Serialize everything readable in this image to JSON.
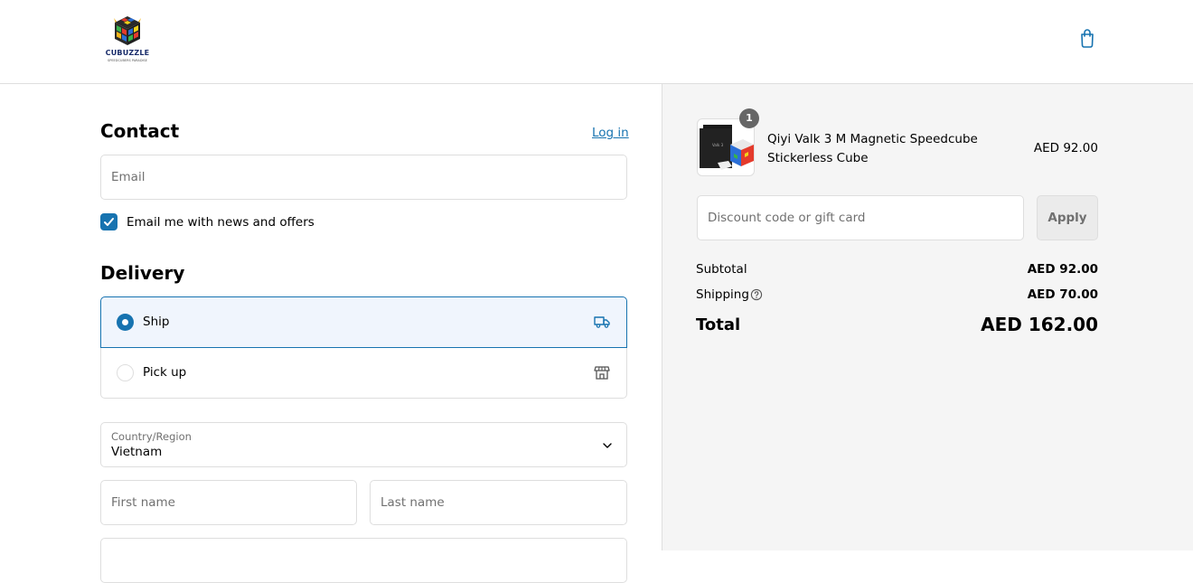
{
  "header": {
    "logo_text": "CUBUZZLE",
    "logo_sub": "SPEEDCUBERS PARADISE",
    "cart_icon": "shopping-bag-icon"
  },
  "contact": {
    "title": "Contact",
    "login_label": "Log in",
    "email_placeholder": "Email",
    "newsletter_label": "Email me with news and offers",
    "newsletter_checked": true
  },
  "delivery": {
    "title": "Delivery",
    "options": [
      {
        "label": "Ship",
        "selected": true,
        "icon": "truck-icon"
      },
      {
        "label": "Pick up",
        "selected": false,
        "icon": "store-icon"
      }
    ],
    "country_label": "Country/Region",
    "country_value": "Vietnam",
    "first_name_placeholder": "First name",
    "last_name_placeholder": "Last name"
  },
  "summary": {
    "product": {
      "name": "Qiyi Valk 3 M Magnetic Speedcube Stickerless Cube",
      "price": "AED 92.00",
      "quantity": "1"
    },
    "discount_placeholder": "Discount code or gift card",
    "apply_label": "Apply",
    "subtotal_label": "Subtotal",
    "subtotal_value": "AED 92.00",
    "shipping_label": "Shipping",
    "shipping_value": "AED 70.00",
    "total_label": "Total",
    "total_value": "AED 162.00"
  },
  "colors": {
    "accent": "#1773b0",
    "pane_bg": "#f5f5f5",
    "selected_bg": "#f0f5fd"
  }
}
